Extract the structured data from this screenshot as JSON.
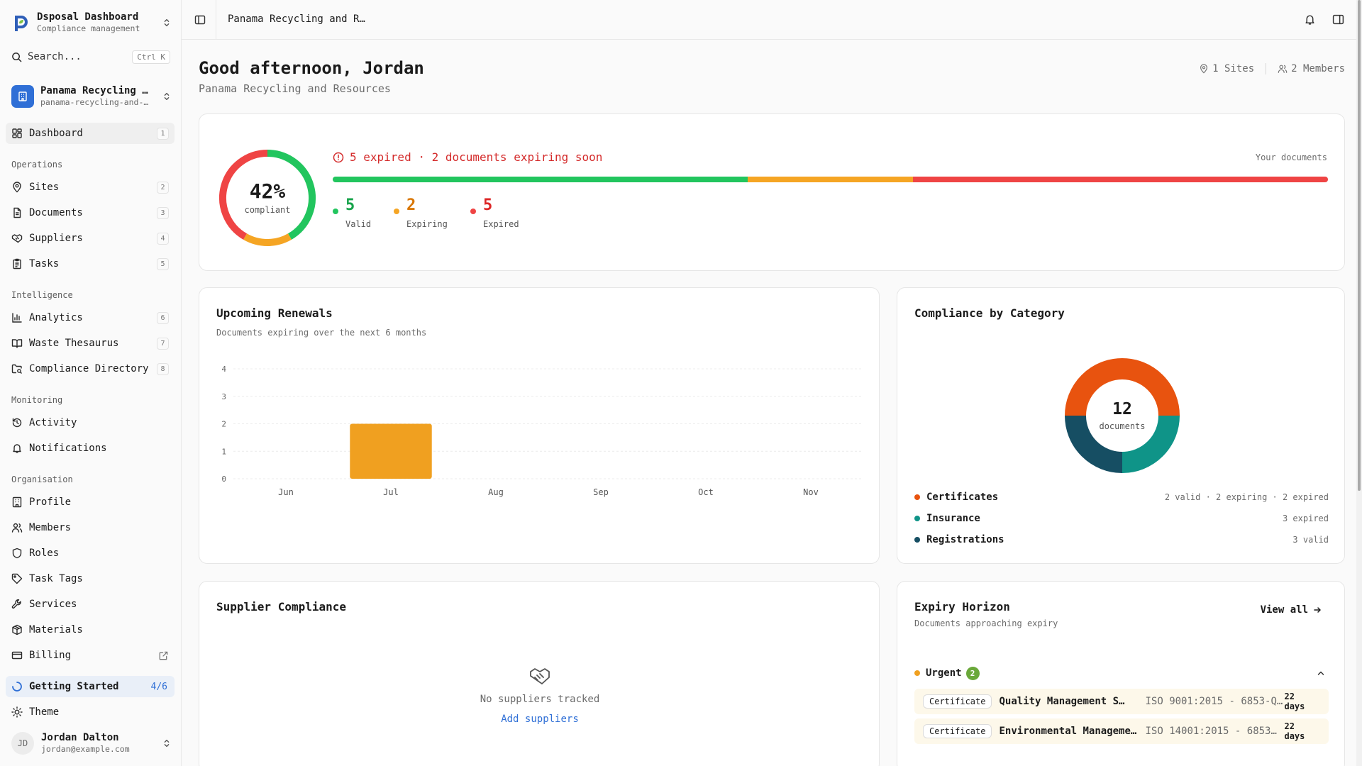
{
  "sidebar": {
    "brand_title": "Dsposal Dashboard",
    "brand_subtitle": "Compliance management",
    "search_label": "Search...",
    "search_shortcut": "Ctrl K",
    "org_name": "Panama Recycling …",
    "org_slug": "panama-recycling-and-…",
    "dashboard": {
      "label": "Dashboard",
      "num": "1"
    },
    "operations_label": "Operations",
    "operations": [
      {
        "label": "Sites",
        "num": "2"
      },
      {
        "label": "Documents",
        "num": "3"
      },
      {
        "label": "Suppliers",
        "num": "4"
      },
      {
        "label": "Tasks",
        "num": "5"
      }
    ],
    "intelligence_label": "Intelligence",
    "intelligence": [
      {
        "label": "Analytics",
        "num": "6"
      },
      {
        "label": "Waste Thesaurus",
        "num": "7"
      },
      {
        "label": "Compliance Directory",
        "num": "8"
      }
    ],
    "monitoring_label": "Monitoring",
    "monitoring": [
      {
        "label": "Activity"
      },
      {
        "label": "Notifications"
      }
    ],
    "organisation_label": "Organisation",
    "organisation": [
      {
        "label": "Profile"
      },
      {
        "label": "Members"
      },
      {
        "label": "Roles"
      },
      {
        "label": "Task Tags"
      },
      {
        "label": "Services"
      },
      {
        "label": "Materials"
      },
      {
        "label": "Billing"
      }
    ],
    "getting_started_label": "Getting Started",
    "getting_started_count": "4/6",
    "theme_label": "Theme",
    "user_initials": "JD",
    "user_name": "Jordan Dalton",
    "user_email": "jordan@example.com"
  },
  "header": {
    "breadcrumb": "Panama Recycling and R…"
  },
  "main": {
    "greeting": "Good afternoon, Jordan",
    "org_full_name": "Panama Recycling and Resources",
    "sites_meta": "1 Sites",
    "members_meta": "2 Members"
  },
  "summary": {
    "compliance_percent": 42,
    "compliance_label": "42%",
    "compliance_sublabel": "compliant",
    "alert_text": "5 expired · 2 documents expiring soon",
    "your_documents_label": "Your documents",
    "stats": [
      {
        "value": "5",
        "label": "Valid",
        "color": "#22c55e"
      },
      {
        "value": "2",
        "label": "Expiring",
        "color": "#f5a524"
      },
      {
        "value": "5",
        "label": "Expired",
        "color": "#ef4444"
      }
    ]
  },
  "renewals": {
    "title": "Upcoming Renewals",
    "subtitle": "Documents expiring over the next 6 months"
  },
  "chart_data": {
    "type": "bar",
    "title": "Upcoming Renewals",
    "categories": [
      "Jun",
      "Jul",
      "Aug",
      "Sep",
      "Oct",
      "Nov"
    ],
    "values": [
      0,
      2,
      0,
      0,
      0,
      0
    ],
    "ylim": [
      0,
      4
    ],
    "yticks": [
      0,
      1,
      2,
      3,
      4
    ],
    "grid": true,
    "color": "#f0a020"
  },
  "category": {
    "title": "Compliance by Category",
    "total": "12",
    "total_label": "documents",
    "items": [
      {
        "name": "Certificates",
        "detail": "2 valid · 2 expiring · 2 expired",
        "count": 6,
        "color": "#e8530f"
      },
      {
        "name": "Insurance",
        "detail": "3 expired",
        "count": 3,
        "color": "#0f9488"
      },
      {
        "name": "Registrations",
        "detail": "3 valid",
        "count": 3,
        "color": "#164e63"
      }
    ]
  },
  "suppliers": {
    "title": "Supplier Compliance",
    "empty_text": "No suppliers tracked",
    "add_link": "Add suppliers"
  },
  "expiry": {
    "title": "Expiry Horizon",
    "subtitle": "Documents approaching expiry",
    "view_all": "View all",
    "urgent_label": "Urgent",
    "urgent_count": "2",
    "docs": [
      {
        "type": "Certificate",
        "name": "Quality Management S…",
        "ref": "ISO 9001:2015 - 6853-QM…",
        "days": "22 days"
      },
      {
        "type": "Certificate",
        "name": "Environmental Manageme…",
        "ref": "ISO 14001:2015 - 6853…",
        "days": "22 days"
      }
    ]
  }
}
